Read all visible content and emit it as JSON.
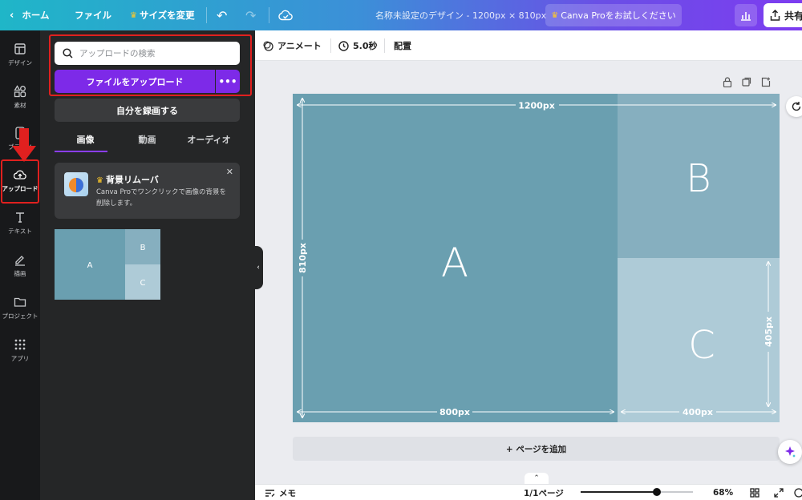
{
  "topbar": {
    "home_label": "ホーム",
    "file_label": "ファイル",
    "resize_label": "サイズを変更",
    "doc_title": "名称未設定のデザイン - 1200px × 810px",
    "pro_label": "Canva Proをお試しください",
    "share_label": "共有"
  },
  "rail": {
    "items": [
      {
        "label": "デザイン",
        "icon": "layout-icon"
      },
      {
        "label": "素材",
        "icon": "shapes-icon"
      },
      {
        "label": "ブランド",
        "icon": "brand-icon"
      },
      {
        "label": "アップロード",
        "icon": "cloud-upload-icon"
      },
      {
        "label": "テキスト",
        "icon": "text-icon"
      },
      {
        "label": "描画",
        "icon": "draw-icon"
      },
      {
        "label": "プロジェクト",
        "icon": "folder-icon"
      },
      {
        "label": "アプリ",
        "icon": "apps-icon"
      }
    ]
  },
  "panel": {
    "search_placeholder": "アップロードの検索",
    "upload_label": "ファイルをアップロード",
    "record_label": "自分を録画する",
    "tabs": [
      {
        "label": "画像"
      },
      {
        "label": "動画"
      },
      {
        "label": "オーディオ"
      }
    ],
    "promo": {
      "title": "背景リムーバ",
      "body": "Canva Proでワンクリックで画像の背景を削除します。"
    },
    "thumb_labels": {
      "a": "A",
      "b": "B",
      "c": "C"
    }
  },
  "editor_toolbar": {
    "animate_label": "アニメート",
    "duration_label": "5.0秒",
    "position_label": "配置"
  },
  "canvas": {
    "colors": {
      "a": "#6a9fb0",
      "b": "#86afbf",
      "c": "#aecbd7",
      "guide": "#ffffff"
    },
    "labels": {
      "a": "A",
      "b": "B",
      "c": "C"
    },
    "dim_labels": {
      "width_total": "1200px",
      "height_total": "810px",
      "width_a": "800px",
      "width_c": "400px",
      "height_c": "405px"
    }
  },
  "add_page_label": "+ ページを追加",
  "bottombar": {
    "notes_label": "メモ",
    "page_label": "1/1ページ",
    "zoom_label": "68%",
    "zoom_fraction": 0.68
  },
  "accent": {
    "purple": "#7d2ae8",
    "highlight_red": "#e0201f"
  }
}
